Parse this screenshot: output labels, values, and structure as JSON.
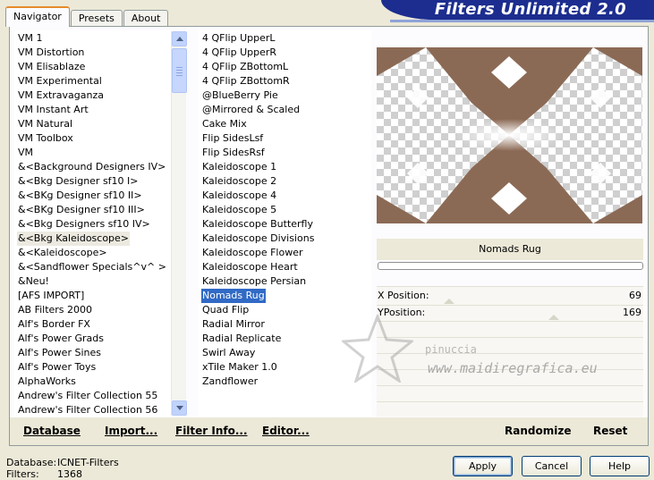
{
  "title": "Filters Unlimited 2.0",
  "tabs": [
    {
      "label": "Navigator"
    },
    {
      "label": "Presets"
    },
    {
      "label": "About"
    }
  ],
  "categories": [
    "VM 1",
    "VM Distortion",
    "VM Elisablaze",
    "VM Experimental",
    "VM Extravaganza",
    "VM Instant Art",
    "VM Natural",
    "VM Toolbox",
    "VM",
    "&<Background Designers IV>",
    "&<Bkg Designer sf10 I>",
    "&<BKg Designer sf10 II>",
    "&<BKg Designer sf10 III>",
    "&<Bkg Designers sf10 IV>",
    "&<Bkg Kaleidoscope>",
    "&<Kaleidoscope>",
    "&<Sandflower Specials^v^ >",
    "&Neu!",
    "[AFS IMPORT]",
    "AB Filters 2000",
    "Alf's Border FX",
    "Alf's Power Grads",
    "Alf's Power Sines",
    "Alf's Power Toys",
    "AlphaWorks",
    "Andrew's Filter Collection 55",
    "Andrew's Filter Collection 56"
  ],
  "selected_category": "&<Bkg Kaleidoscope>",
  "filters": [
    "4 QFlip UpperL",
    "4 QFlip UpperR",
    "4 QFlip ZBottomL",
    "4 QFlip ZBottomR",
    "@BlueBerry Pie",
    "@Mirrored & Scaled",
    "Cake Mix",
    "Flip SidesLsf",
    "Flip SidesRsf",
    "Kaleidoscope 1",
    "Kaleidoscope 2",
    "Kaleidoscope 4",
    "Kaleidoscope 5",
    "Kaleidoscope Butterfly",
    "Kaleidoscope Divisions",
    "Kaleidoscope Flower",
    "Kaleidoscope Heart",
    "Kaleidoscope Persian",
    "Nomads Rug",
    "Quad Flip",
    "Radial Mirror",
    "Radial Replicate",
    "Swirl Away",
    "xTile Maker 1.0",
    "Zandflower"
  ],
  "selected_filter": "Nomads Rug",
  "preview": {
    "filter_name": "Nomads Rug",
    "pattern_color": "#8b6a55"
  },
  "params": [
    {
      "label": "X Position:",
      "value": "69"
    },
    {
      "label": "YPosition:",
      "value": "169"
    }
  ],
  "bottom_buttons": {
    "database": "Database",
    "import": "Import...",
    "filter_info": "Filter Info...",
    "editor": "Editor...",
    "randomize": "Randomize",
    "reset": "Reset"
  },
  "footer": {
    "database_label": "Database:",
    "database_value": "ICNET-Filters",
    "filters_label": "Filters:",
    "filters_value": "1368"
  },
  "dialog_buttons": {
    "apply": "Apply",
    "cancel": "Cancel",
    "help": "Help"
  },
  "watermark": {
    "line1": "pinuccia",
    "line2": "www.maidiregrafica.eu"
  }
}
